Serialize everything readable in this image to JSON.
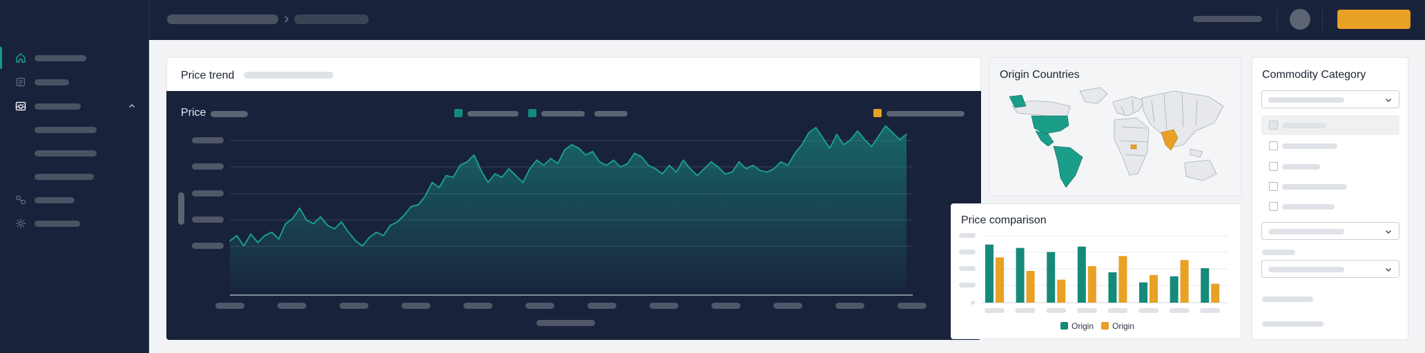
{
  "price_trend": {
    "title": "Price trend",
    "chart_label": "Price",
    "chart_data": {
      "type": "area",
      "title": "",
      "ylabel": "Price",
      "ylim": [
        0,
        100
      ],
      "grid": true,
      "legend": "top",
      "series": [
        {
          "color": "#1a9e8a",
          "values": [
            42,
            45,
            39,
            46,
            41,
            45,
            47,
            43,
            52,
            55,
            61,
            54,
            52,
            56,
            51,
            49,
            53,
            47,
            42,
            39,
            44,
            47,
            45,
            51,
            53,
            57,
            62,
            63,
            68,
            76,
            73,
            80,
            79,
            86,
            88,
            92,
            83,
            76,
            81,
            79,
            84,
            80,
            76,
            84,
            89,
            86,
            90,
            87,
            95,
            98,
            96,
            92,
            94,
            88,
            86,
            89,
            85,
            87,
            93,
            91,
            86,
            84,
            81,
            86,
            82,
            89,
            84,
            80,
            84,
            88,
            85,
            81,
            82,
            88,
            84,
            86,
            83,
            82,
            84,
            88,
            86,
            93,
            98,
            105,
            108,
            102,
            96,
            104,
            98,
            101,
            106,
            101,
            97,
            103,
            109,
            105,
            101,
            104
          ]
        }
      ]
    }
  },
  "origin_countries": {
    "title": "Origin Countries"
  },
  "price_comparison": {
    "title": "Price comparison",
    "chart_data": {
      "type": "bar",
      "title": "",
      "ylim": [
        0,
        100
      ],
      "grid": true,
      "legend": "bottom",
      "series": [
        {
          "name": "Origin",
          "color": "#168a7a",
          "values": [
            86,
            81,
            75,
            83,
            45,
            30,
            39,
            51
          ]
        },
        {
          "name": "Origin",
          "color": "#e8a025",
          "values": [
            67,
            47,
            34,
            54,
            69,
            41,
            63,
            28
          ]
        }
      ]
    }
  },
  "commodity_category": {
    "title": "Commodity Category"
  },
  "colors": {
    "navy": "#18223a",
    "accent": "#e8a025",
    "teal": "#168a7a",
    "active": "#169a86"
  },
  "icons": {
    "breadcrumb_separator": "chevron-right-icon",
    "nav": [
      "home-icon",
      "document-icon",
      "inbox-icon",
      "link-icon",
      "gear-icon"
    ],
    "nav_expand": "chevron-up-icon",
    "select": "chevron-down-icon"
  }
}
